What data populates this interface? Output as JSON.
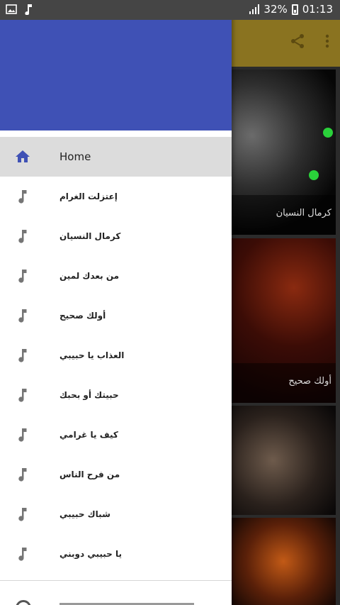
{
  "status_bar": {
    "battery": "32%",
    "time": "01:13",
    "left_icons": [
      "image-icon",
      "music-note-icon"
    ]
  },
  "toolbar": {
    "icons": [
      "share-icon",
      "more-vert-icon"
    ]
  },
  "background": {
    "tiles": [
      {
        "caption": "كرمال النسيان"
      },
      {
        "caption": "أولك صحيح"
      },
      {
        "caption": ""
      },
      {
        "caption": ""
      }
    ]
  },
  "drawer": {
    "header_color": "#3f51b5",
    "menu": [
      {
        "label": "Home",
        "icon": "home-icon",
        "selected": true
      },
      {
        "label": "إعتزلت الغرام",
        "icon": "music-note-icon"
      },
      {
        "label": "كرمال النسيان",
        "icon": "music-note-icon"
      },
      {
        "label": "من بعدك لمين",
        "icon": "music-note-icon"
      },
      {
        "label": "أولك صحيح",
        "icon": "music-note-icon"
      },
      {
        "label": "العذاب يا حبيبي",
        "icon": "music-note-icon"
      },
      {
        "label": "حبيتك أو بحبك",
        "icon": "music-note-icon"
      },
      {
        "label": "كيف يا غرامي",
        "icon": "music-note-icon"
      },
      {
        "label": "من فرح الناس",
        "icon": "music-note-icon"
      },
      {
        "label": "شباك حبيبي",
        "icon": "music-note-icon"
      },
      {
        "label": "يا حبيبي دوبني",
        "icon": "music-note-icon"
      }
    ]
  }
}
